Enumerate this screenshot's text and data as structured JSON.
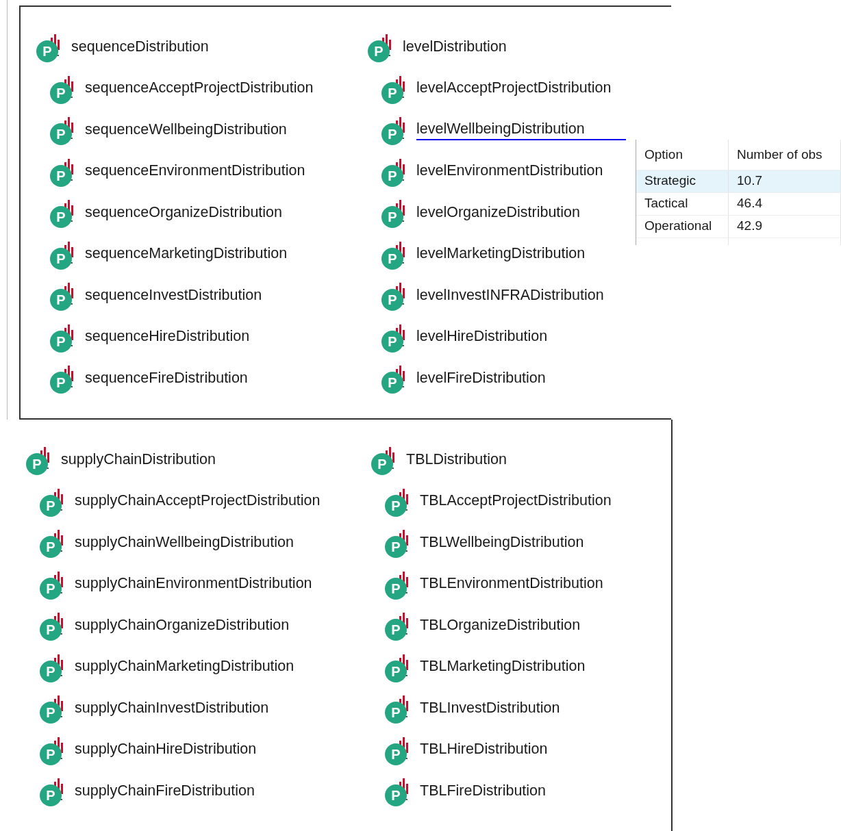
{
  "panels": [
    {
      "columns": [
        {
          "header": {
            "label": "sequenceDistribution",
            "icon_letter": "P",
            "hovered": false
          },
          "items": [
            {
              "label": "sequenceAcceptProjectDistribution",
              "icon_letter": "P",
              "hovered": false
            },
            {
              "label": "sequenceWellbeingDistribution",
              "icon_letter": "P",
              "hovered": false
            },
            {
              "label": "sequenceEnvironmentDistribution",
              "icon_letter": "P",
              "hovered": false
            },
            {
              "label": "sequenceOrganizeDistribution",
              "icon_letter": "P",
              "hovered": false
            },
            {
              "label": "sequenceMarketingDistribution",
              "icon_letter": "P",
              "hovered": false
            },
            {
              "label": "sequenceInvestDistribution",
              "icon_letter": "P",
              "hovered": false
            },
            {
              "label": "sequenceHireDistribution",
              "icon_letter": "P",
              "hovered": false
            },
            {
              "label": "sequenceFireDistribution",
              "icon_letter": "P",
              "hovered": false
            }
          ]
        },
        {
          "header": {
            "label": "levelDistribution",
            "icon_letter": "P",
            "hovered": false
          },
          "items": [
            {
              "label": "levelAcceptProjectDistribution",
              "icon_letter": "P",
              "hovered": false
            },
            {
              "label": "levelWellbeingDistribution",
              "icon_letter": "P",
              "hovered": true
            },
            {
              "label": "levelEnvironmentDistribution",
              "icon_letter": "P",
              "hovered": false
            },
            {
              "label": "levelOrganizeDistribution",
              "icon_letter": "P",
              "hovered": false
            },
            {
              "label": "levelMarketingDistribution",
              "icon_letter": "P",
              "hovered": false
            },
            {
              "label": "levelInvestINFRADistribution",
              "icon_letter": "P",
              "hovered": false
            },
            {
              "label": "levelHireDistribution",
              "icon_letter": "P",
              "hovered": false
            },
            {
              "label": "levelFireDistribution",
              "icon_letter": "P",
              "hovered": false
            }
          ]
        }
      ]
    },
    {
      "columns": [
        {
          "header": {
            "label": "supplyChainDistribution",
            "icon_letter": "P",
            "hovered": false
          },
          "items": [
            {
              "label": "supplyChainAcceptProjectDistribution",
              "icon_letter": "P",
              "hovered": false
            },
            {
              "label": "supplyChainWellbeingDistribution",
              "icon_letter": "P",
              "hovered": false
            },
            {
              "label": "supplyChainEnvironmentDistribution",
              "icon_letter": "P",
              "hovered": false
            },
            {
              "label": "supplyChainOrganizeDistribution",
              "icon_letter": "P",
              "hovered": false
            },
            {
              "label": "supplyChainMarketingDistribution",
              "icon_letter": "P",
              "hovered": false
            },
            {
              "label": "supplyChainInvestDistribution",
              "icon_letter": "P",
              "hovered": false
            },
            {
              "label": "supplyChainHireDistribution",
              "icon_letter": "P",
              "hovered": false
            },
            {
              "label": "supplyChainFireDistribution",
              "icon_letter": "P",
              "hovered": false
            }
          ]
        },
        {
          "header": {
            "label": "TBLDistribution",
            "icon_letter": "P",
            "hovered": false
          },
          "items": [
            {
              "label": "TBLAcceptProjectDistribution",
              "icon_letter": "P",
              "hovered": false
            },
            {
              "label": "TBLWellbeingDistribution",
              "icon_letter": "P",
              "hovered": false
            },
            {
              "label": "TBLEnvironmentDistribution",
              "icon_letter": "P",
              "hovered": false
            },
            {
              "label": "TBLOrganizeDistribution",
              "icon_letter": "P",
              "hovered": false
            },
            {
              "label": "TBLMarketingDistribution",
              "icon_letter": "P",
              "hovered": false
            },
            {
              "label": "TBLInvestDistribution",
              "icon_letter": "P",
              "hovered": false
            },
            {
              "label": "TBLHireDistribution",
              "icon_letter": "P",
              "hovered": false
            },
            {
              "label": "TBLFireDistribution",
              "icon_letter": "P",
              "hovered": false
            }
          ]
        }
      ]
    }
  ],
  "tooltip_table": {
    "columns": [
      "Option",
      "Number of obs"
    ],
    "rows": [
      {
        "cells": [
          "Strategic",
          "10.7"
        ],
        "selected": true
      },
      {
        "cells": [
          "Tactical",
          "46.4"
        ],
        "selected": false
      },
      {
        "cells": [
          "Operational",
          "42.9"
        ],
        "selected": false
      }
    ]
  }
}
